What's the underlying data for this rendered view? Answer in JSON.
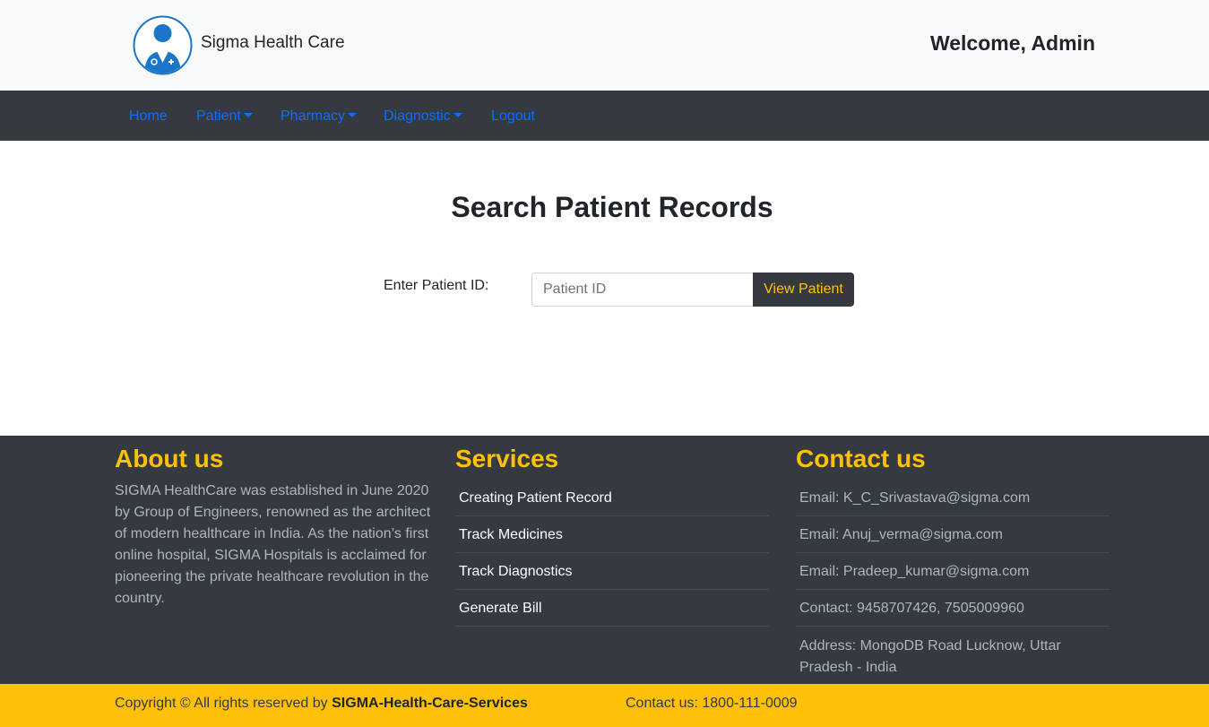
{
  "header": {
    "brand": "Sigma Health Care",
    "welcome": "Welcome, Admin"
  },
  "nav": {
    "home": "Home",
    "patient": "Patient",
    "pharmacy": "Pharmacy",
    "diagnostic": "Diagnostic",
    "logout": "Logout"
  },
  "main": {
    "title": "Search Patient Records",
    "field_label": "Enter Patient ID:",
    "input_placeholder": "Patient ID",
    "input_value": "",
    "button_label": "View Patient"
  },
  "footer": {
    "about": {
      "title": "About us",
      "text": "SIGMA HealthCare was established in June 2020 by Group of Engineers, renowned as the architect of modern healthcare in India. As the nation’s first online hospital, SIGMA Hospitals is acclaimed for pioneering the private healthcare revolution in the country."
    },
    "services": {
      "title": "Services",
      "items": [
        "Creating Patient Record",
        "Track Medicines",
        "Track Diagnostics",
        "Generate Bill"
      ]
    },
    "contact": {
      "title": "Contact us",
      "items": [
        "Email: K_C_Srivastava@sigma.com",
        "Email: Anuj_verma@sigma.com",
        "Email: Pradeep_kumar@sigma.com",
        "Contact: 9458707426, 7505009960",
        "Address: MongoDB Road Lucknow, Uttar Pradesh - India"
      ]
    }
  },
  "bottom": {
    "copyright_prefix": "Copyright © All rights reserved by",
    "copyright_brand": "SIGMA-Health-Care-Services",
    "contact": "Contact us: 1800-111-0009"
  },
  "colors": {
    "dark": "#343a40",
    "accent_yellow": "#ffc107",
    "link_blue": "#0d6efd",
    "logo_blue": "#1976c8",
    "light_bg": "#f8f9fa"
  },
  "icons": {
    "logo": "doctor-avatar-icon",
    "dropdown": "caret-down-icon"
  }
}
